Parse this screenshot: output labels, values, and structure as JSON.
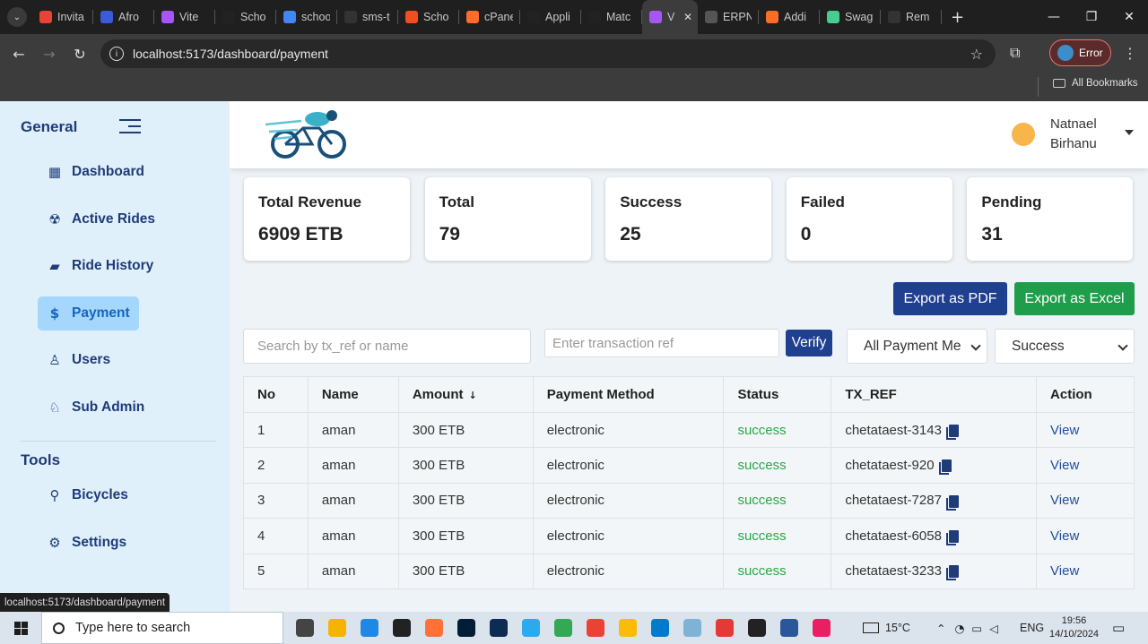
{
  "browser": {
    "tabs": [
      {
        "label": "Invita",
        "icon": "gmail-icon",
        "color": "#ea4335"
      },
      {
        "label": "Afro",
        "icon": "afro-icon",
        "color": "#3b5bdb"
      },
      {
        "label": "Vite",
        "icon": "vite-icon",
        "color": "#a855f7"
      },
      {
        "label": "Scho",
        "icon": "vercel-icon",
        "color": "#222222"
      },
      {
        "label": "schoo",
        "icon": "docs-icon",
        "color": "#4285f4"
      },
      {
        "label": "sms-t",
        "icon": "github-icon",
        "color": "#333333"
      },
      {
        "label": "Scho",
        "icon": "figma-icon",
        "color": "#f24e1e"
      },
      {
        "label": "cPane",
        "icon": "cpanel-icon",
        "color": "#ff6c2c"
      },
      {
        "label": "Appli",
        "icon": "app-icon",
        "color": "#222222"
      },
      {
        "label": "Matc",
        "icon": "matc-icon",
        "color": "#222222"
      },
      {
        "label": "V",
        "icon": "vite-icon",
        "color": "#a855f7"
      },
      {
        "label": "ERPN",
        "icon": "openai-icon",
        "color": "#555555"
      },
      {
        "label": "Addi",
        "icon": "gitlab-icon",
        "color": "#fc6d26"
      },
      {
        "label": "Swag",
        "icon": "swagger-icon",
        "color": "#49cc90"
      },
      {
        "label": "Rem",
        "icon": "github-icon",
        "color": "#333333"
      }
    ],
    "active_tab": 10,
    "url": "localhost:5173/dashboard/payment",
    "error_label": "Error",
    "bookmarks_label": "All Bookmarks",
    "status_url": "localhost:5173/dashboard/payment"
  },
  "sidebar": {
    "general_label": "General",
    "tools_label": "Tools",
    "items": [
      {
        "label": "Dashboard",
        "icon": "dashboard-icon",
        "glyph": "▦"
      },
      {
        "label": "Active Rides",
        "icon": "active-rides-icon",
        "glyph": "☢"
      },
      {
        "label": "Ride History",
        "icon": "ride-history-icon",
        "glyph": "▰"
      },
      {
        "label": "Payment",
        "icon": "dollar-icon",
        "glyph": "$"
      },
      {
        "label": "Users",
        "icon": "user-icon",
        "glyph": "♙"
      },
      {
        "label": "Sub Admin",
        "icon": "sub-admin-icon",
        "glyph": "♘"
      }
    ],
    "tools": [
      {
        "label": "Bicycles",
        "icon": "bicycle-icon",
        "glyph": "⚲"
      },
      {
        "label": "Settings",
        "icon": "gear-icon",
        "glyph": "⚙"
      }
    ],
    "active_item": "Payment"
  },
  "header": {
    "user_first": "Natnael",
    "user_last": "Birhanu"
  },
  "stats": [
    {
      "label": "Total Revenue",
      "value": "6909 ETB"
    },
    {
      "label": "Total",
      "value": "79"
    },
    {
      "label": "Success",
      "value": "25"
    },
    {
      "label": "Failed",
      "value": "0"
    },
    {
      "label": "Pending",
      "value": "31"
    }
  ],
  "actions": {
    "export_pdf": "Export as PDF",
    "export_excel": "Export as Excel",
    "verify": "Verify",
    "pdf_color": "#1f3f8f",
    "excel_color": "#1e9e4a"
  },
  "filters": {
    "search_placeholder": "Search by tx_ref or name",
    "tx_ref_placeholder": "Enter transaction ref",
    "payment_method": "All Payment Me",
    "status": "Success"
  },
  "table": {
    "headers": [
      "No",
      "Name",
      "Amount",
      "Payment Method",
      "Status",
      "TX_REF",
      "Action"
    ],
    "rows": [
      {
        "no": "1",
        "name": "aman",
        "amount": "300 ETB",
        "method": "electronic",
        "status": "success",
        "tx_ref": "chetataest-3143",
        "action": "View"
      },
      {
        "no": "2",
        "name": "aman",
        "amount": "300 ETB",
        "method": "electronic",
        "status": "success",
        "tx_ref": "chetataest-920",
        "action": "View"
      },
      {
        "no": "3",
        "name": "aman",
        "amount": "300 ETB",
        "method": "electronic",
        "status": "success",
        "tx_ref": "chetataest-7287",
        "action": "View"
      },
      {
        "no": "4",
        "name": "aman",
        "amount": "300 ETB",
        "method": "electronic",
        "status": "success",
        "tx_ref": "chetataest-6058",
        "action": "View"
      },
      {
        "no": "5",
        "name": "aman",
        "amount": "300 ETB",
        "method": "electronic",
        "status": "success",
        "tx_ref": "chetataest-3233",
        "action": "View"
      }
    ]
  },
  "taskbar": {
    "search_placeholder": "Type here to search",
    "weather": "15°C",
    "language": "ENG",
    "time": "19:56",
    "date": "14/10/2024",
    "apps": [
      {
        "icon": "task-view-icon",
        "color": "#444444"
      },
      {
        "icon": "file-explorer-icon",
        "color": "#f4b400"
      },
      {
        "icon": "edge-icon",
        "color": "#1e88e5"
      },
      {
        "icon": "affinity-icon",
        "color": "#222222"
      },
      {
        "icon": "firefox-icon",
        "color": "#ff7139"
      },
      {
        "icon": "photoshop-icon",
        "color": "#001e36"
      },
      {
        "icon": "photoshop-icon",
        "color": "#0d2c54"
      },
      {
        "icon": "telegram-icon",
        "color": "#2aabee"
      },
      {
        "icon": "chrome-icon",
        "color": "#34a853"
      },
      {
        "icon": "chrome-icon",
        "color": "#ea4335"
      },
      {
        "icon": "chrome-icon",
        "color": "#fbbc05"
      },
      {
        "icon": "vscode-icon",
        "color": "#007acc"
      },
      {
        "icon": "app-icon",
        "color": "#7fb3d5"
      },
      {
        "icon": "wps-icon",
        "color": "#e53935"
      },
      {
        "icon": "terminal-icon",
        "color": "#222222"
      },
      {
        "icon": "word-icon",
        "color": "#2b579a"
      },
      {
        "icon": "paint-icon",
        "color": "#e91e63"
      }
    ]
  }
}
